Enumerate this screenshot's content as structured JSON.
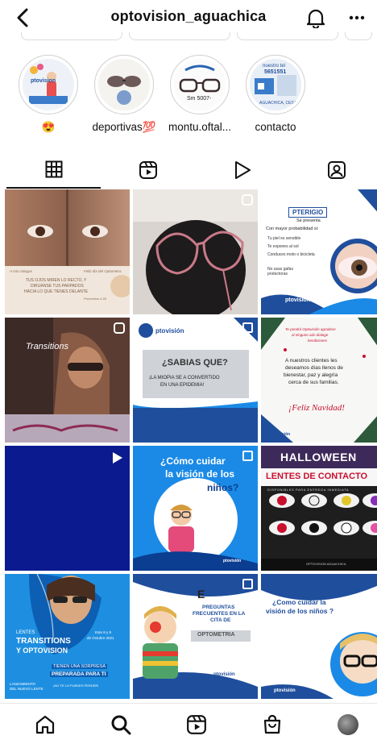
{
  "header": {
    "username": "optovision_aguachica"
  },
  "highlights": [
    {
      "label": "😍",
      "pic_text": "ptovision"
    },
    {
      "label": "deportivas💯",
      "pic_text": ""
    },
    {
      "label": "montu.oftal...",
      "pic_text": "Sm 5007-"
    },
    {
      "label": "contacto",
      "pic_text_top": "nuestro tel",
      "pic_text_num": "5651551",
      "pic_text_bottom": "AGUACHICA, CESAR"
    }
  ],
  "posts": {
    "p1": {
      "line1": "TUS OJOS MIREN LO RECTO, Y",
      "line2": "DIRIJANSE TUS PARPADOS",
      "line3": "HACIA LO QUE TIENES DELANTE",
      "ref": "Proverbios 4:25",
      "corner_left": "A mis colegas",
      "corner_right": "Feliz dia del Optometra"
    },
    "p3": {
      "title": "PTERIGIO",
      "sub1": "Se presenta",
      "sub2": "Con mayor probabilidad si:",
      "bullets": [
        "Tu piel es sensible",
        "Te expones al sol",
        "Conduces moto o bicicleta",
        "No usas gafas protectoras"
      ],
      "brand": "ptovisión"
    },
    "p4": {
      "brand": "Transitions"
    },
    "p5": {
      "brand": "ptovisión",
      "q": "¿SABIAS QUE?",
      "fact1": "¡LA MIOPIA SE A CONVERTIDO",
      "fact2": "EN UNA EPIDEMIA!"
    },
    "p6": {
      "top1": "Te pondrá Optovisión agradece",
      "top2": "al ninguno aún dialogo",
      "top3": "bendiciones",
      "msg1": "A nuestros clientes les",
      "msg2": "deseamos días llenos de",
      "msg3": "bienestar, paz y alegría",
      "msg4": "cerca de sus familias.",
      "feliz": "¡Feliz Navidad!",
      "brand": "ptovisión"
    },
    "p8": {
      "line1": "¿Cómo cuidar",
      "line2": "la visión de los",
      "line3": "niños?",
      "brand": "ptovisión"
    },
    "p9": {
      "title": "HALLOWEEN",
      "sub": "LENTES DE CONTACTO",
      "disp": "DISPONIBLES PARA ENTREGA INMEDIATA",
      "footer": "OPTOVISION AGUACHICA"
    },
    "p10": {
      "small": "LENTES",
      "title1": "TRANSITIONS",
      "title2": "Y OPTOVISION",
      "date1": "Este 8 y 9",
      "date2": "de Octubre 2021",
      "promo1": "TIENEN UNA SORPRESA",
      "promo2": "PREPARADA PARA TI",
      "launch1": "LANZAMIENTO",
      "launch2": "DEL NUEVO LENTE",
      "cta": "¡NO TE LO PUEDES PERDER!"
    },
    "p11": {
      "t1": "PREGUNTAS",
      "t2": "FRECUENTES EN LA",
      "t3": "CITA DE",
      "t4": "OPTOMETRIA",
      "brand": "ptovisión"
    },
    "p12": {
      "line1": "¿Como cuidar la",
      "line2": "visión de los niños ?",
      "brand": "ptovisión"
    }
  },
  "colors": {
    "blue": "#1f4e9c",
    "navy": "#0b1a8f",
    "sky": "#1b8ae6",
    "halloween_red": "#c8102e"
  }
}
